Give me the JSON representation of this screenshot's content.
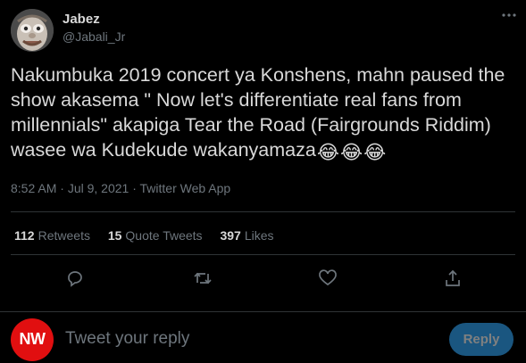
{
  "author": {
    "display_name": "Jabez",
    "handle": "@Jabali_Jr",
    "avatar_icon": "cartoon-face-avatar"
  },
  "tweet": {
    "text": "Nakumbuka 2019 concert ya Konshens, mahn paused the show akasema \" Now let's differentiate real fans from millennials\" akapiga Tear the Road (Fairgrounds Riddim) wasee wa Kudekude wakanyamaza",
    "emojis": [
      "😂",
      "😂",
      "😂"
    ],
    "time": "8:52 AM",
    "date": "Jul 9, 2021",
    "source": "Twitter Web App",
    "separator": "·"
  },
  "stats": {
    "retweets": {
      "count": "112",
      "label": "Retweets"
    },
    "quote_tweets": {
      "count": "15",
      "label": "Quote Tweets"
    },
    "likes": {
      "count": "397",
      "label": "Likes"
    }
  },
  "actions": [
    "reply-icon",
    "retweet-icon",
    "like-icon",
    "share-icon"
  ],
  "reply": {
    "avatar_text": "NW",
    "placeholder": "Tweet your reply",
    "button_label": "Reply"
  },
  "colors": {
    "background": "#000000",
    "text": "#d9d9d9",
    "muted": "#6e767d",
    "divider": "#2f3336",
    "reply_button": "#1a5680",
    "nw_red": "#e10f10",
    "emoji_yellow": "#f7c443"
  }
}
